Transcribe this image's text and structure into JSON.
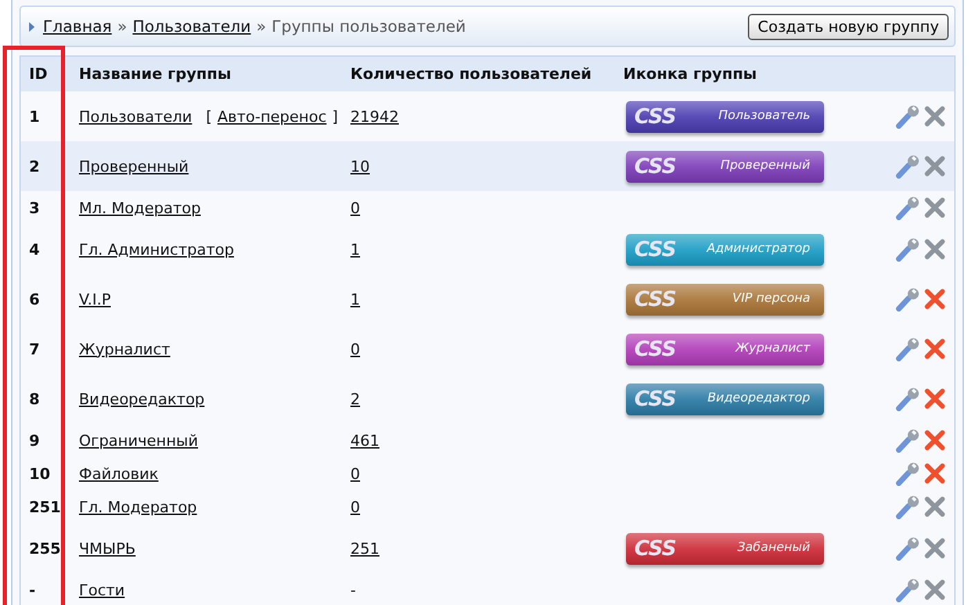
{
  "breadcrumb": [
    {
      "label": "Главная",
      "link": true
    },
    {
      "label": "Пользователи",
      "link": true
    },
    {
      "label": "Группы пользователей",
      "link": false
    }
  ],
  "breadcrumb_separator": "»",
  "create_button": "Создать новую группу",
  "highlight_id_column": true,
  "table": {
    "columns": [
      "ID",
      "Название группы",
      "Количество пользователей",
      "Иконка группы"
    ],
    "rows": [
      {
        "id": "1",
        "name": "Пользователи",
        "extra": {
          "open": "[",
          "label": "Авто-перенос",
          "close": "]"
        },
        "count": "21942",
        "badge": {
          "logo": "CSS",
          "label": "Пользователь",
          "color": "#4a3cb0"
        },
        "deletable": false,
        "selected": false
      },
      {
        "id": "2",
        "name": "Проверенный",
        "count": "10",
        "badge": {
          "logo": "CSS",
          "label": "Проверенный",
          "color": "#7c3cb8"
        },
        "deletable": false,
        "selected": true
      },
      {
        "id": "3",
        "name": "Мл. Модератор",
        "count": "0",
        "deletable": false,
        "selected": false
      },
      {
        "id": "4",
        "name": "Гл. Администратор",
        "count": "1",
        "badge": {
          "logo": "CSS",
          "label": "Администратор",
          "color": "#1a9cc4"
        },
        "deletable": false,
        "selected": false
      },
      {
        "id": "6",
        "name": "V.I.P",
        "count": "1",
        "badge": {
          "logo": "CSS",
          "label": "VIP персона",
          "color": "#a87436"
        },
        "deletable": true,
        "selected": false
      },
      {
        "id": "7",
        "name": "Журналист",
        "count": "0",
        "badge": {
          "logo": "CSS",
          "label": "Журналист",
          "color": "#b03cb8"
        },
        "deletable": true,
        "selected": false
      },
      {
        "id": "8",
        "name": "Видеоредактор",
        "count": "2",
        "badge": {
          "logo": "CSS",
          "label": "Видеоредактор",
          "color": "#2a7aa4"
        },
        "deletable": true,
        "selected": false
      },
      {
        "id": "9",
        "name": "Ограниченный",
        "count": "461",
        "deletable": true,
        "selected": false
      },
      {
        "id": "10",
        "name": "Файловик",
        "count": "0",
        "deletable": true,
        "selected": false
      },
      {
        "id": "251",
        "name": "Гл. Модератор",
        "count": "0",
        "deletable": false,
        "selected": false
      },
      {
        "id": "255",
        "name": "ЧМЫРЬ",
        "count": "251",
        "badge": {
          "logo": "CSS",
          "label": "Забаненый",
          "color": "#cc2a36"
        },
        "deletable": false,
        "selected": false
      },
      {
        "id": "-",
        "name": "Гости",
        "count": "-",
        "count_link": false,
        "deletable": false,
        "selected": false
      }
    ]
  }
}
